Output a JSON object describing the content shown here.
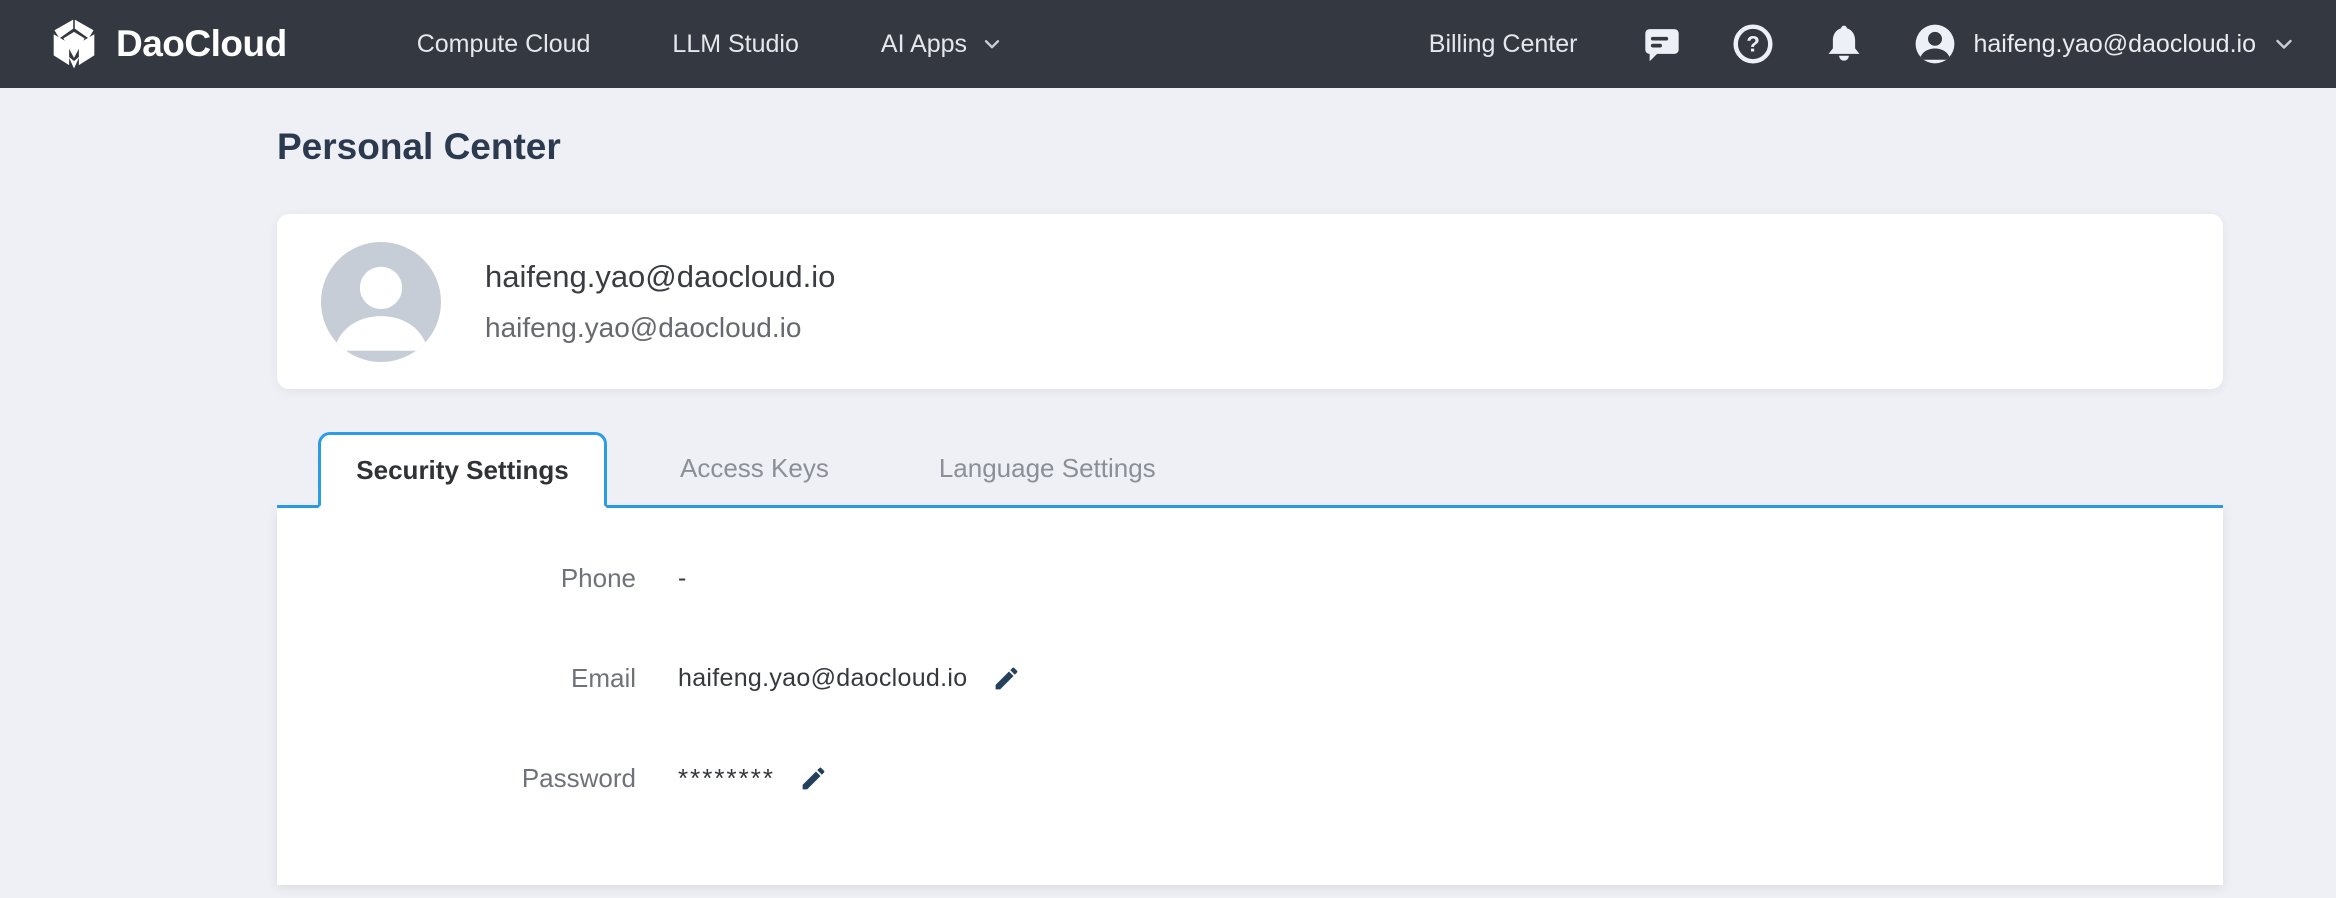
{
  "navbar": {
    "brand": "DaoCloud",
    "links": [
      {
        "label": "Compute Cloud"
      },
      {
        "label": "LLM Studio"
      },
      {
        "label": "AI Apps",
        "has_dropdown": true
      }
    ],
    "billing_center_label": "Billing Center",
    "user_email": "haifeng.yao@daocloud.io",
    "icons": {
      "message": "speech-bubble",
      "help": "question-mark-circle",
      "notifications": "bell",
      "account": "person-circle",
      "dropdown": "chevron-down"
    }
  },
  "page": {
    "title": "Personal Center"
  },
  "profile_card": {
    "display_name": "haifeng.yao@daocloud.io",
    "email": "haifeng.yao@daocloud.io"
  },
  "tabs": [
    {
      "label": "Security Settings",
      "active": true
    },
    {
      "label": "Access Keys",
      "active": false
    },
    {
      "label": "Language Settings",
      "active": false
    }
  ],
  "security_settings": {
    "rows": [
      {
        "label": "Phone",
        "value": "-",
        "editable": false
      },
      {
        "label": "Email",
        "value": "haifeng.yao@daocloud.io",
        "editable": true
      },
      {
        "label": "Password",
        "value": "********",
        "editable": true
      }
    ]
  },
  "colors": {
    "navbar_bg": "#343841",
    "accent_blue": "#2b9ce8",
    "page_bg": "#eef0f5",
    "title_text": "#2c3a4f",
    "edit_icon": "#24405c",
    "avatar_bg": "#c6cdd7"
  }
}
